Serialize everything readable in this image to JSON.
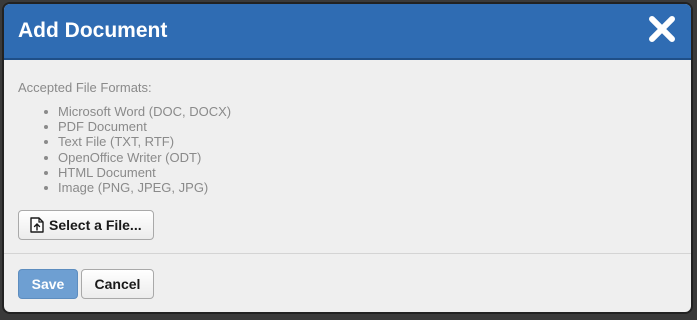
{
  "dialog": {
    "title": "Add Document",
    "close_icon": "close-icon"
  },
  "content": {
    "formats_label": "Accepted File Formats:",
    "formats": [
      "Microsoft Word (DOC, DOCX)",
      "PDF Document",
      "Text File (TXT, RTF)",
      "OpenOffice Writer (ODT)",
      "HTML Document",
      "Image (PNG, JPEG, JPG)"
    ],
    "select_file_label": "Select a File...",
    "select_file_icon": "file-upload-icon"
  },
  "footer": {
    "save_label": "Save",
    "cancel_label": "Cancel"
  },
  "colors": {
    "header": "#2f6cb3",
    "primary_button": "#6e9fd2",
    "body_background": "#efefef",
    "muted_text": "#8a8a8a"
  }
}
